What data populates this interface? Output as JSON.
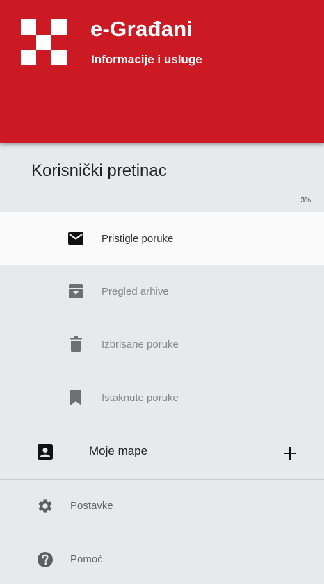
{
  "header": {
    "title": "e-Građani",
    "subtitle": "Informacije i usluge",
    "brand_color": "#cc1a24",
    "logo_icon": "checkerboard-logo"
  },
  "mailbox": {
    "title": "Korisnički pretinac",
    "quota_label": "3%",
    "items": [
      {
        "label": "Pristigle poruke",
        "icon": "envelope-icon",
        "active": true
      },
      {
        "label": "Pregled arhive",
        "icon": "archive-icon",
        "active": false
      },
      {
        "label": "Izbrisane poruke",
        "icon": "trash-icon",
        "active": false
      },
      {
        "label": "Istaknute poruke",
        "icon": "bookmark-icon",
        "active": false
      }
    ]
  },
  "folders": {
    "label": "Moje mape",
    "icon": "contact-card-icon",
    "add_icon": "plus-icon"
  },
  "utilities": [
    {
      "label": "Postavke",
      "icon": "gear-icon"
    },
    {
      "label": "Pomoć",
      "icon": "help-icon"
    }
  ]
}
